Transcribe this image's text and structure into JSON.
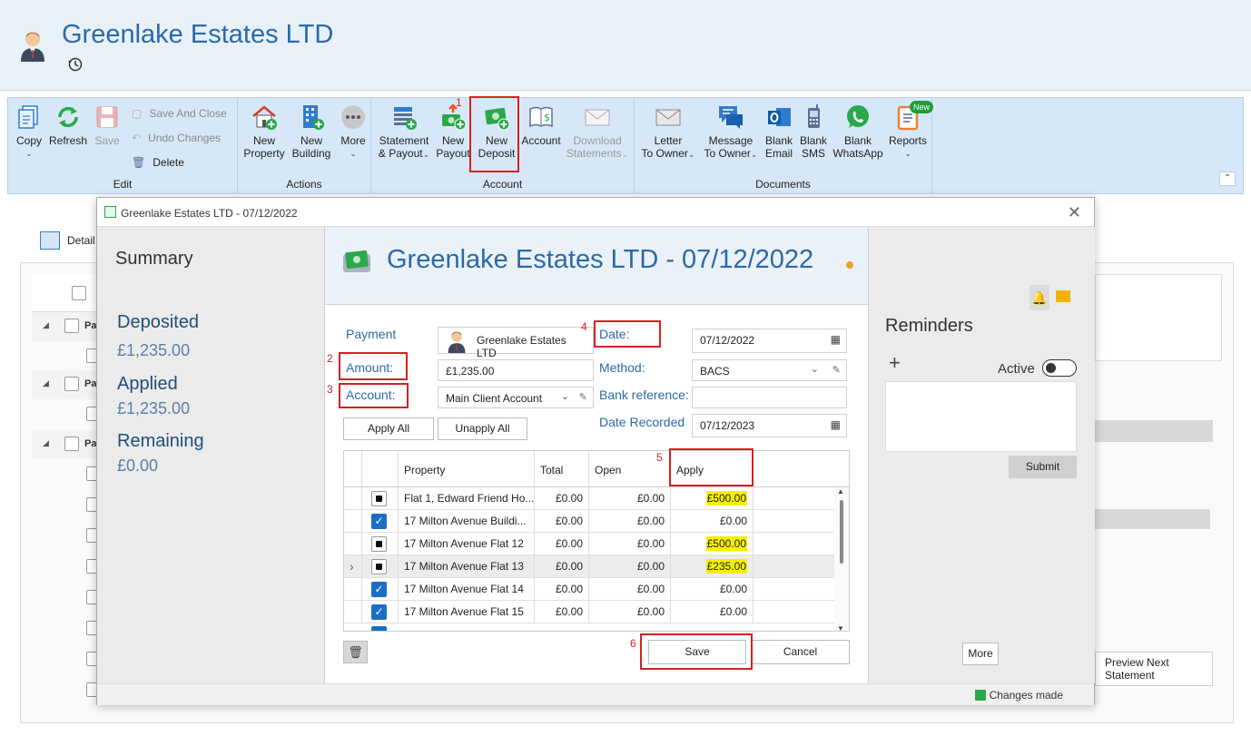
{
  "app": {
    "title": "Greenlake Estates LTD"
  },
  "ribbon": {
    "edit": {
      "label": "Edit",
      "copy": "Copy",
      "refresh": "Refresh",
      "save": "Save",
      "save_and_close": "Save And Close",
      "undo_changes": "Undo Changes",
      "delete": "Delete"
    },
    "actions": {
      "label": "Actions",
      "new_property": [
        "New",
        "Property"
      ],
      "new_building": [
        "New",
        "Building"
      ],
      "more": "More"
    },
    "account": {
      "label": "Account",
      "statement_payout": [
        "Statement",
        "& Payout"
      ],
      "new_payout": [
        "New",
        "Payout"
      ],
      "new_deposit": [
        "New",
        "Deposit"
      ],
      "account": "Account",
      "download_statements": [
        "Download",
        "Statements"
      ]
    },
    "documents": {
      "label": "Documents",
      "letter_to_owner": [
        "Letter",
        "To Owner"
      ],
      "message_to_owner": [
        "Message",
        "To Owner"
      ],
      "blank_email": [
        "Blank",
        "Email"
      ],
      "blank_sms": [
        "Blank",
        "SMS"
      ],
      "blank_whatsapp": [
        "Blank",
        "WhatsApp"
      ],
      "reports": "Reports",
      "new_badge": "New"
    }
  },
  "annotations": [
    "1",
    "2",
    "3",
    "4",
    "5",
    "6"
  ],
  "background": {
    "details_tab": "Detail",
    "row_prefix": "Pa",
    "preview_next_statement": [
      "Preview Next",
      "Statement"
    ]
  },
  "dialog": {
    "window_title": "Greenlake Estates LTD - 07/12/2022",
    "header_title": "Greenlake Estates LTD - 07/12/2022",
    "summary": {
      "heading": "Summary",
      "deposited_label": "Deposited",
      "deposited_value": "£1,235.00",
      "applied_label": "Applied",
      "applied_value": "£1,235.00",
      "remaining_label": "Remaining",
      "remaining_value": "£0.00"
    },
    "form": {
      "payment_label": "Payment",
      "payment_value": "Greenlake Estates LTD",
      "amount_label": "Amount:",
      "amount_value": "£1,235.00",
      "account_label": "Account:",
      "account_value": "Main Client Account",
      "date_label": "Date:",
      "date_value": "07/12/2022",
      "method_label": "Method:",
      "method_value": "BACS",
      "bank_reference_label": "Bank reference:",
      "bank_reference_value": "",
      "date_recorded_label": "Date Recorded",
      "date_recorded_value": "07/12/2023",
      "apply_all": "Apply All",
      "unapply_all": "Unapply All"
    },
    "grid": {
      "columns": [
        "Property",
        "Total",
        "Open",
        "Apply"
      ],
      "rows": [
        {
          "property": "Flat 1, Edward Friend Ho...",
          "total": "£0.00",
          "open": "£0.00",
          "apply": "£500.00",
          "state": "indeterminate",
          "highlight": true
        },
        {
          "property": "17 Milton Avenue Buildi...",
          "total": "£0.00",
          "open": "£0.00",
          "apply": "£0.00",
          "state": "checked",
          "highlight": false
        },
        {
          "property": "17 Milton Avenue Flat 12",
          "total": "£0.00",
          "open": "£0.00",
          "apply": "£500.00",
          "state": "indeterminate",
          "highlight": true
        },
        {
          "property": "17 Milton Avenue Flat 13",
          "total": "£0.00",
          "open": "£0.00",
          "apply": "£235.00",
          "state": "indeterminate",
          "highlight": true
        },
        {
          "property": "17 Milton Avenue Flat 14",
          "total": "£0.00",
          "open": "£0.00",
          "apply": "£0.00",
          "state": "checked",
          "highlight": false
        },
        {
          "property": "17 Milton Avenue Flat 15",
          "total": "£0.00",
          "open": "£0.00",
          "apply": "£0.00",
          "state": "checked",
          "highlight": false
        }
      ]
    },
    "save": "Save",
    "cancel": "Cancel",
    "reminders": {
      "heading": "Reminders",
      "active_label": "Active",
      "submit": "Submit",
      "more": "More"
    },
    "status": "Changes made"
  },
  "colors": {
    "accent": "#2a6aa8",
    "annotation_red": "#d62020",
    "highlight_yellow": "#f4f000",
    "checkbox_blue": "#1a6fc4"
  }
}
